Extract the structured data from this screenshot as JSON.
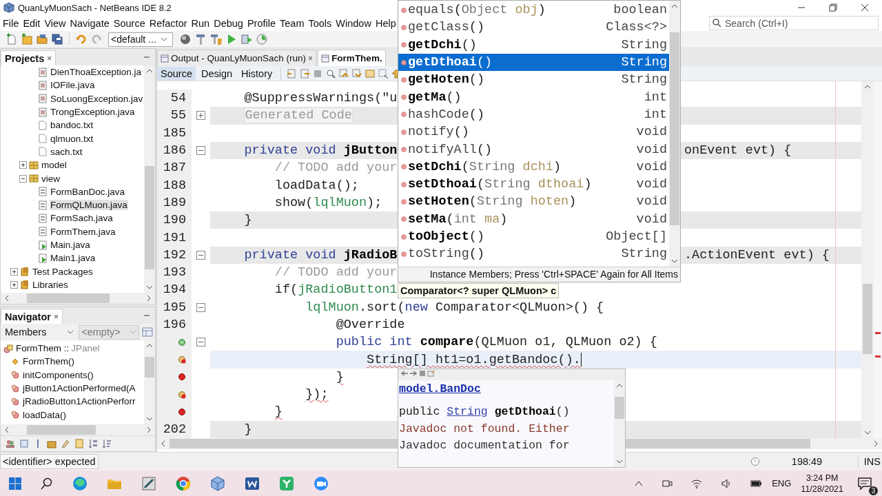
{
  "window": {
    "title": "QuanLyMuonSach - NetBeans IDE 8.2"
  },
  "menu": [
    "File",
    "Edit",
    "View",
    "Navigate",
    "Source",
    "Refactor",
    "Run",
    "Debug",
    "Profile",
    "Team",
    "Tools",
    "Window",
    "Help"
  ],
  "search": {
    "placeholder": "Search (Ctrl+I)"
  },
  "toolbar": {
    "configuration": "<default ..."
  },
  "projects": {
    "title": "Projects",
    "close": "×",
    "tree": [
      {
        "children": [
          {
            "children": [
              {
                "label": "DienThoaException.ja",
                "kind": "class",
                "selected": false
              },
              {
                "label": "IOFile.java",
                "kind": "class",
                "selected": false
              },
              {
                "label": "SoLuongException.jav",
                "kind": "class",
                "selected": false
              },
              {
                "label": "TrongException.java",
                "kind": "class",
                "selected": false
              },
              {
                "label": "bandoc.txt",
                "kind": "text",
                "selected": false
              },
              {
                "label": "qlmuon.txt",
                "kind": "text",
                "selected": false
              },
              {
                "label": "sach.txt",
                "kind": "text",
                "selected": false
              }
            ]
          },
          {
            "label": "model",
            "kind": "package",
            "expanded": false,
            "selected": false
          },
          {
            "label": "view",
            "kind": "package",
            "expanded": true,
            "selected": false,
            "children": [
              {
                "label": "FormBanDoc.java",
                "kind": "form",
                "selected": false
              },
              {
                "label": "FormQLMuon.java",
                "kind": "form",
                "selected": true
              },
              {
                "label": "FormSach.java",
                "kind": "form",
                "selected": false
              },
              {
                "label": "FormThem.java",
                "kind": "form",
                "selected": false
              },
              {
                "label": "Main.java",
                "kind": "main",
                "selected": false
              },
              {
                "label": "Main1.java",
                "kind": "main",
                "selected": false
              }
            ]
          }
        ]
      },
      {
        "label": "Test Packages",
        "kind": "library",
        "expanded": false,
        "selected": false
      },
      {
        "label": "Libraries",
        "kind": "library",
        "expanded": false,
        "selected": false
      }
    ]
  },
  "navigator": {
    "title": "Navigator",
    "close": "×",
    "filter": "Members",
    "secondary": "<empty>",
    "root": {
      "label": "FormThem ::",
      "type": "JPanel",
      "children": [
        {
          "label": "FormThem()",
          "kind": "constructor"
        },
        {
          "label": "initComponents()",
          "kind": "method"
        },
        {
          "label": "jButton1ActionPerformed(A",
          "kind": "method"
        },
        {
          "label": "jRadioButton1ActionPerforr",
          "kind": "method"
        },
        {
          "label": "loadData()",
          "kind": "method"
        }
      ]
    }
  },
  "editor": {
    "tabs": [
      {
        "label": "Output - QuanLyMuonSach (run)",
        "close": "×",
        "selected": false
      },
      {
        "label": "FormThem.",
        "selected": true
      }
    ],
    "views": [
      {
        "label": "Source",
        "selected": true
      },
      {
        "label": "Design",
        "selected": false
      },
      {
        "label": "History",
        "selected": false
      }
    ],
    "lines": [
      {
        "number": "54",
        "kind": "plain",
        "caret": false,
        "error": false,
        "left": [
          {
            "text": "@SuppressWarnings(\"u",
            "kind": "plain"
          }
        ]
      },
      {
        "number": "55",
        "kind": "declaration",
        "collapsed": true,
        "caret": false,
        "error": false,
        "left": [
          {
            "text": "Generated Code",
            "kind": "folded"
          }
        ]
      },
      {
        "number": "185",
        "kind": "plain",
        "caret": false
      },
      {
        "number": "186",
        "kind": "declaration",
        "collapsed": false,
        "caret": false,
        "error": false,
        "left": [
          {
            "text": "private void ",
            "kind": "keyword"
          },
          {
            "text": "jButton",
            "kind": "name"
          }
        ],
        "right": [
          {
            "text": "onEvent evt) {",
            "kind": "plain"
          }
        ],
        "children": [
          {
            "number": "187",
            "kind": "plain",
            "caret": false,
            "error": false,
            "left": [
              {
                "text": "// TODO add your",
                "kind": "comment"
              }
            ]
          },
          {
            "number": "188",
            "kind": "plain",
            "caret": false,
            "error": false,
            "left": [
              {
                "text": "loadData();",
                "kind": "plain"
              }
            ]
          },
          {
            "number": "189",
            "kind": "plain",
            "caret": false,
            "error": false,
            "left": [
              {
                "text": "show(",
                "kind": "plain"
              },
              {
                "text": "lqlMuon",
                "kind": "field"
              },
              {
                "text": ");",
                "kind": "plain"
              }
            ]
          }
        ]
      },
      {
        "number": "190",
        "kind": "declaration",
        "caret": false,
        "error": false,
        "left": [
          {
            "text": "}",
            "kind": "plain"
          }
        ]
      },
      {
        "number": "191",
        "kind": "plain",
        "caret": false
      },
      {
        "number": "192",
        "kind": "declaration",
        "collapsed": false,
        "caret": false,
        "error": false,
        "left": [
          {
            "text": "private void ",
            "kind": "keyword"
          },
          {
            "text": "jRadioB",
            "kind": "name"
          }
        ],
        "right": [
          {
            "text": ".ActionEvent evt) {",
            "kind": "plain"
          }
        ],
        "children": [
          {
            "number": "193",
            "kind": "plain",
            "caret": false,
            "error": false,
            "left": [
              {
                "text": "// TODO add your",
                "kind": "comment"
              }
            ]
          },
          {
            "number": "194",
            "kind": "plain",
            "caret": false,
            "error": false,
            "left": [
              {
                "text": "if(",
                "kind": "plain"
              },
              {
                "text": "jRadioButton1",
                "kind": "field"
              }
            ],
            "children": [
              {
                "number": "195",
                "kind": "plain",
                "collapsed": false,
                "caret": false,
                "error": false,
                "left": [
                  {
                    "text": "lqlMuon",
                    "kind": "field"
                  },
                  {
                    "text": ".sort(",
                    "kind": "plain"
                  },
                  {
                    "text": "new ",
                    "kind": "keyword"
                  },
                  {
                    "text": "Comparator<QLMuon>() {",
                    "kind": "plain"
                  }
                ],
                "children": [
                  {
                    "number": "196",
                    "kind": "plain",
                    "caret": false,
                    "error": false,
                    "left": [
                      {
                        "text": "@Override",
                        "kind": "plain"
                      }
                    ]
                  },
                  {
                    "annotation": {
                      "kind": "override"
                    },
                    "kind": "plain",
                    "collapsed": false,
                    "caret": false,
                    "error": false,
                    "left": [
                      {
                        "text": "public int ",
                        "kind": "keyword"
                      },
                      {
                        "text": "compare",
                        "kind": "name"
                      },
                      {
                        "text": "(QLMuon o1, QLMuon o2) {",
                        "kind": "plain"
                      }
                    ],
                    "children": [
                      {
                        "annotation": {
                          "kind": "hint-error"
                        },
                        "kind": "current",
                        "caret": true,
                        "error": true,
                        "left": [
                          {
                            "text": "String[] ht1=o1.getBandoc().",
                            "kind": "plain"
                          }
                        ]
                      }
                    ]
                  },
                  {
                    "annotation": {
                      "kind": "error"
                    },
                    "kind": "plain",
                    "caret": false,
                    "error": true,
                    "left": [
                      {
                        "text": "}",
                        "kind": "plain"
                      }
                    ]
                  }
                ]
              },
              {
                "annotation": {
                  "kind": "hint-error"
                },
                "kind": "plain",
                "caret": false,
                "error": true,
                "left": [
                  {
                    "text": "});",
                    "kind": "plain"
                  }
                ]
              }
            ]
          },
          {
            "annotation": {
              "kind": "error"
            },
            "kind": "plain",
            "caret": false,
            "error": true,
            "left": [
              {
                "text": "}",
                "kind": "plain"
              }
            ]
          }
        ]
      },
      {
        "number": "202",
        "kind": "declaration",
        "caret": false,
        "error": false,
        "left": [
          {
            "text": "}",
            "kind": "plain"
          }
        ]
      }
    ]
  },
  "completion": {
    "items": [
      {
        "name": "equals",
        "args": [
          {
            "text": "(",
            "kind": "plain"
          },
          {
            "text": "Object ",
            "kind": "type"
          },
          {
            "text": "obj",
            "kind": "param"
          },
          {
            "text": ")",
            "kind": "plain"
          }
        ],
        "type": "boolean",
        "own": false,
        "selected": false
      },
      {
        "name": "getClass",
        "args": [
          {
            "text": "()",
            "kind": "plain"
          }
        ],
        "type": "Class<?>",
        "own": false,
        "selected": false
      },
      {
        "name": "getDchi",
        "args": [
          {
            "text": "()",
            "kind": "plain"
          }
        ],
        "type": "String",
        "own": true,
        "selected": false
      },
      {
        "name": "getDthoai",
        "args": [
          {
            "text": "()",
            "kind": "plain"
          }
        ],
        "type": "String",
        "own": true,
        "selected": true
      },
      {
        "name": "getHoten",
        "args": [
          {
            "text": "()",
            "kind": "plain"
          }
        ],
        "type": "String",
        "own": true,
        "selected": false
      },
      {
        "name": "getMa",
        "args": [
          {
            "text": "()",
            "kind": "plain"
          }
        ],
        "type": "int",
        "own": true,
        "selected": false
      },
      {
        "name": "hashCode",
        "args": [
          {
            "text": "()",
            "kind": "plain"
          }
        ],
        "type": "int",
        "own": false,
        "selected": false
      },
      {
        "name": "notify",
        "args": [
          {
            "text": "()",
            "kind": "plain"
          }
        ],
        "type": "void",
        "own": false,
        "selected": false
      },
      {
        "name": "notifyAll",
        "args": [
          {
            "text": "()",
            "kind": "plain"
          }
        ],
        "type": "void",
        "own": false,
        "selected": false
      },
      {
        "name": "setDchi",
        "args": [
          {
            "text": "(",
            "kind": "plain"
          },
          {
            "text": "String ",
            "kind": "type"
          },
          {
            "text": "dchi",
            "kind": "param"
          },
          {
            "text": ")",
            "kind": "plain"
          }
        ],
        "type": "void",
        "own": true,
        "selected": false
      },
      {
        "name": "setDthoai",
        "args": [
          {
            "text": "(",
            "kind": "plain"
          },
          {
            "text": "String ",
            "kind": "type"
          },
          {
            "text": "dthoai",
            "kind": "param"
          },
          {
            "text": ")",
            "kind": "plain"
          }
        ],
        "type": "void",
        "own": true,
        "selected": false
      },
      {
        "name": "setHoten",
        "args": [
          {
            "text": "(",
            "kind": "plain"
          },
          {
            "text": "String ",
            "kind": "type"
          },
          {
            "text": "hoten",
            "kind": "param"
          },
          {
            "text": ")",
            "kind": "plain"
          }
        ],
        "type": "void",
        "own": true,
        "selected": false
      },
      {
        "name": "setMa",
        "args": [
          {
            "text": "(",
            "kind": "plain"
          },
          {
            "text": "int ",
            "kind": "type"
          },
          {
            "text": "ma",
            "kind": "param"
          },
          {
            "text": ")",
            "kind": "plain"
          }
        ],
        "type": "void",
        "own": true,
        "selected": false
      },
      {
        "name": "toObject",
        "args": [
          {
            "text": "()",
            "kind": "plain"
          }
        ],
        "type": "Object[]",
        "own": true,
        "selected": false
      },
      {
        "name": "toString",
        "args": [
          {
            "text": "()",
            "kind": "plain"
          }
        ],
        "type": "String",
        "own": false,
        "selected": false
      }
    ],
    "footer": "Instance Members; Press 'Ctrl+SPACE' Again for All Items"
  },
  "tooltip": "Comparator<? super QLMuon> c",
  "javadoc": {
    "class": "model.BanDoc",
    "signature": [
      {
        "text": "public ",
        "kind": "plain"
      },
      {
        "text": "String",
        "kind": "link"
      },
      {
        "text": "getDthoai",
        "kind": "name"
      },
      {
        "text": "()",
        "kind": "plain"
      }
    ],
    "text": [
      "Javadoc not found. Either",
      "Javadoc documentation for"
    ]
  },
  "status": {
    "message": "<identifier> expected",
    "position": "198:49",
    "mode": "INS"
  },
  "taskbar": {
    "language": "ENG",
    "time": "3:24 PM",
    "date": "11/28/2021",
    "notifications": "3"
  }
}
